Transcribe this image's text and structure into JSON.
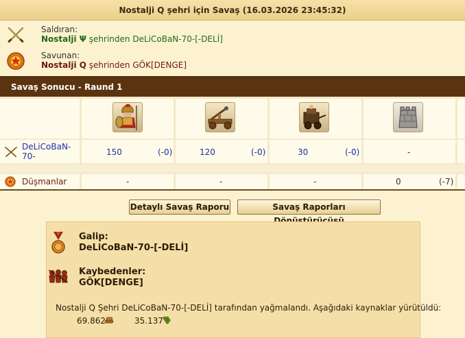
{
  "title": "Nostalji Q şehri için Savaş (16.03.2026 23:45:32)",
  "attacker": {
    "role_label": "Saldıran:",
    "city": "Nostalji Ψ",
    "text_from": " şehrinden ",
    "player": "DeLiCoBaN-70-[-DELİ]",
    "icon": "crossed-swords-icon"
  },
  "defender": {
    "role_label": "Savunan:",
    "city": "Nostalji Q",
    "text_from": " şehrinden ",
    "player": "GÖK[DENGE]",
    "icon": "shield-target-icon"
  },
  "round_bar": "Savaş Sonucu - Raund 1",
  "units": [
    {
      "name": "hoplite-unit-icon"
    },
    {
      "name": "catapult-unit-icon"
    },
    {
      "name": "chariot-unit-icon"
    },
    {
      "name": "wall-unit-icon"
    }
  ],
  "attacker_row": {
    "name": "DeLiCoBaN-70-",
    "cells": [
      {
        "value": "150",
        "loss": "(-0)"
      },
      {
        "value": "120",
        "loss": "(-0)"
      },
      {
        "value": "30",
        "loss": "(-0)"
      },
      {
        "value": "-",
        "loss": ""
      }
    ]
  },
  "enemy_row": {
    "name": "Düşmanlar",
    "cells": [
      {
        "value": "-",
        "loss": ""
      },
      {
        "value": "-",
        "loss": ""
      },
      {
        "value": "-",
        "loss": ""
      },
      {
        "value": "0",
        "loss": "(-7)"
      }
    ]
  },
  "buttons": {
    "detailed": "Detaylı Savaş Raporu",
    "converter": "Savaş Raporları Dönüştürücüsü"
  },
  "summary": {
    "winner_label": "Galip:",
    "winner_name": "DeLiCoBaN-70-[-DELİ]",
    "losers_label": "Kaybedenler:",
    "losers_name": "GÖK[DENGE]",
    "loot_text": "Nostalji Q Şehri DeLiCoBaN-70-[-DELİ] tarafından yağmalandı. Aşağıdaki kaynaklar yürütüldü:",
    "resources": [
      {
        "amount": "69.862",
        "icon": "wood-icon"
      },
      {
        "amount": "35.137",
        "icon": "wine-icon"
      }
    ]
  }
}
